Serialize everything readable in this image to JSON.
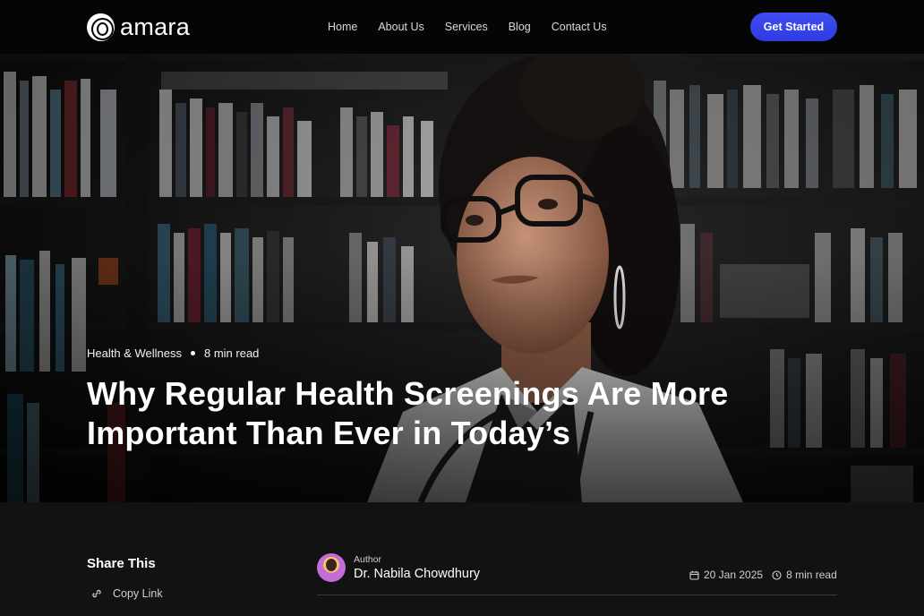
{
  "nav": {
    "brand": "amara",
    "links": [
      "Home",
      "About Us",
      "Services",
      "Blog",
      "Contact Us"
    ],
    "cta_label": "Get Started"
  },
  "hero": {
    "category": "Health & Wellness",
    "read_time": "8 min read",
    "title": "Why Regular Health Screenings Are More Important Than Ever in Today’s"
  },
  "share": {
    "title": "Share This",
    "copy_link_label": "Copy Link"
  },
  "author": {
    "label": "Author",
    "name": "Dr. Nabila Chowdhury"
  },
  "post_info": {
    "date": "20 Jan 2025",
    "read_time": "8 min read"
  },
  "colors": {
    "accent": "#3a47ea",
    "background": "#121212",
    "nav_background": "#050505"
  },
  "icons": [
    "logo-icon",
    "link-icon",
    "calendar-icon",
    "clock-icon"
  ]
}
